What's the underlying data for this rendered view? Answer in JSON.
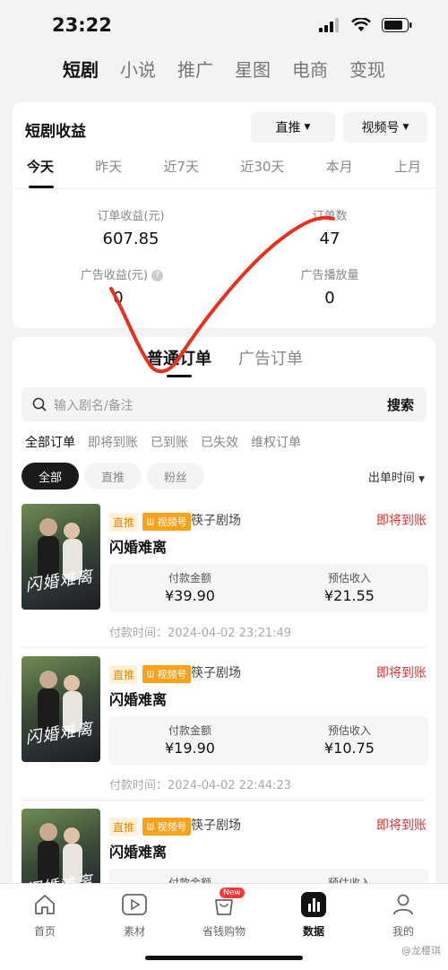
{
  "status_bar": {
    "time": "23:22"
  },
  "top_nav": [
    "短剧",
    "小说",
    "推广",
    "星图",
    "电商",
    "变现"
  ],
  "summary": {
    "title": "短剧收益",
    "dropdown1": "直推",
    "dropdown2": "视频号",
    "date_tabs": [
      "今天",
      "昨天",
      "近7天",
      "近30天",
      "本月",
      "上月"
    ],
    "metrics": [
      {
        "label": "订单收益(元)",
        "value": "607.85"
      },
      {
        "label": "订单数",
        "value": "47"
      },
      {
        "label": "广告收益(元)",
        "value": "0"
      },
      {
        "label": "广告播放量",
        "value": "0"
      }
    ]
  },
  "orders": {
    "tabs": [
      "普通订单",
      "广告订单"
    ],
    "search_placeholder": "输入剧名/备注",
    "search_button": "搜索",
    "filters": [
      "全部订单",
      "即将到账",
      "已到账",
      "已失效",
      "维权订单"
    ],
    "pills": [
      "全部",
      "直推",
      "粉丝"
    ],
    "sort": "出单时间",
    "amount_label": "付款金额",
    "income_label": "预估收入",
    "items": [
      {
        "tag": "直推",
        "platform": "视频号",
        "source": "筷子剧场",
        "status": "即将到账",
        "title": "闪婚难离",
        "poster_text": "闪婚难离",
        "amount": "¥39.90",
        "income": "¥21.55",
        "time": "付款时间：2024-04-02 23:21:49"
      },
      {
        "tag": "直推",
        "platform": "视频号",
        "source": "筷子剧场",
        "status": "即将到账",
        "title": "闪婚难离",
        "poster_text": "闪婚难离",
        "amount": "¥19.90",
        "income": "¥10.75",
        "time": "付款时间：2024-04-02 22:44:23"
      },
      {
        "tag": "直推",
        "platform": "视频号",
        "source": "筷子剧场",
        "status": "即将到账",
        "title": "闪婚难离",
        "poster_text": "闪婚难离",
        "amount": "",
        "income": "",
        "time": ""
      }
    ]
  },
  "tab_bar": {
    "items": [
      "首页",
      "素材",
      "省钱购物",
      "数据",
      "我的"
    ],
    "badge": "New"
  },
  "watermark": "@龙樱琪",
  "colors": {
    "accent_red": "#e03030",
    "tag_orange": "#f7a21b",
    "annotation_red": "#e8301c"
  }
}
